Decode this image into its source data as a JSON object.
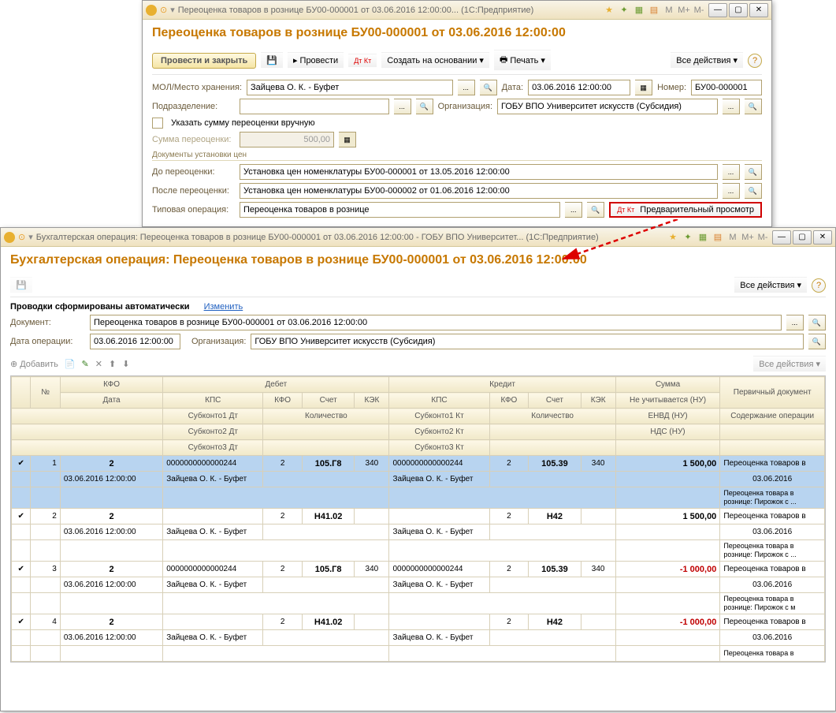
{
  "w1": {
    "title": "Переоценка товаров в рознице БУ00-000001 от 03.06.2016 12:00:00... (1С:Предприятие)",
    "heading": "Переоценка товаров в рознице БУ00-000001 от 03.06.2016 12:00:00",
    "btn_post_close": "Провести и закрыть",
    "btn_post": "Провести",
    "btn_create_based": "Создать на основании",
    "btn_print": "Печать",
    "btn_all_actions": "Все действия",
    "lbl_mol": "МОЛ/Место хранения:",
    "mol": "Зайцева О. К. - Буфет",
    "lbl_date": "Дата:",
    "date": "03.06.2016 12:00:00",
    "lbl_number": "Номер:",
    "number": "БУ00-000001",
    "lbl_dept": "Подразделение:",
    "lbl_org": "Организация:",
    "org": "ГОБУ ВПО Университет искусств (Субсидия)",
    "chk_manual": "Указать сумму переоценки вручную",
    "lbl_sum": "Сумма переоценки:",
    "sum": "500,00",
    "group_docs": "Документы установки цен",
    "lbl_before": "До переоценки:",
    "before": "Установка цен номенклатуры БУ00-000001 от 13.05.2016 12:00:00",
    "lbl_after": "После переоценки:",
    "after": "Установка цен номенклатуры БУ00-000002 от 01.06.2016 12:00:00",
    "lbl_typop": "Типовая операция:",
    "typop": "Переоценка товаров в рознице",
    "btn_preview": "Предварительный просмотр"
  },
  "w2": {
    "title": "Бухгалтерская операция: Переоценка товаров в рознице БУ00-000001 от 03.06.2016 12:00:00 - ГОБУ ВПО Университет... (1С:Предприятие)",
    "heading": "Бухгалтерская операция: Переоценка товаров в рознице БУ00-000001 от 03.06.2016 12:00:00",
    "btn_all_actions": "Все действия",
    "auto_text": "Проводки сформированы автоматически",
    "btn_change": "Изменить",
    "lbl_doc": "Документ:",
    "doc": "Переоценка товаров в рознице БУ00-000001 от 03.06.2016 12:00:00",
    "lbl_opdate": "Дата операции:",
    "opdate": "03.06.2016 12:00:00",
    "lbl_org": "Организация:",
    "org": "ГОБУ ВПО Университет искусств (Субсидия)",
    "btn_add": "Добавить",
    "h": {
      "n": "№",
      "kfo": "КФО",
      "debit": "Дебет",
      "credit": "Кредит",
      "sum": "Сумма",
      "primdoc": "Первичный документ",
      "date": "Дата",
      "kps": "КПС",
      "acct": "Счет",
      "kek": "КЭК",
      "qty": "Количество",
      "envd": "ЕНВД (НУ)",
      "notcount": "Не учитывается (НУ)",
      "sub1d": "Субконто1 Дт",
      "sub2d": "Субконто2 Дт",
      "sub3d": "Субконто3 Дт",
      "sub1k": "Субконто1 Кт",
      "sub2k": "Субконто2 Кт",
      "sub3k": "Субконто3 Кт",
      "nds": "НДС (НУ)",
      "desc": "Содержание операции"
    },
    "rows": [
      {
        "n": "1",
        "kfo": "2",
        "date": "03.06.2016 12:00:00",
        "d_kps": "0000000000000244",
        "d_kfo": "2",
        "d_acct": "105.Г8",
        "d_kek": "340",
        "d_sub1": "Зайцева О. К. - Буфет",
        "k_kps": "0000000000000244",
        "k_kfo": "2",
        "k_acct": "105.39",
        "k_kek": "340",
        "k_sub1": "Зайцева О. К. - Буфет",
        "sum": "1 500,00",
        "doc": "Переоценка товаров в",
        "docdate": "03.06.2016",
        "desc": "Переоценка товара в рознице: Пирожок с ..."
      },
      {
        "n": "2",
        "kfo": "2",
        "date": "03.06.2016 12:00:00",
        "d_kps": "",
        "d_kfo": "2",
        "d_acct": "Н41.02",
        "d_kek": "",
        "d_sub1": "Зайцева О. К. - Буфет",
        "k_kps": "",
        "k_kfo": "2",
        "k_acct": "Н42",
        "k_kek": "",
        "k_sub1": "Зайцева О. К. - Буфет",
        "sum": "1 500,00",
        "doc": "Переоценка товаров в",
        "docdate": "03.06.2016",
        "desc": "Переоценка товара в рознице: Пирожок с ..."
      },
      {
        "n": "3",
        "kfo": "2",
        "date": "03.06.2016 12:00:00",
        "d_kps": "0000000000000244",
        "d_kfo": "2",
        "d_acct": "105.Г8",
        "d_kek": "340",
        "d_sub1": "Зайцева О. К. - Буфет",
        "k_kps": "0000000000000244",
        "k_kfo": "2",
        "k_acct": "105.39",
        "k_kek": "340",
        "k_sub1": "Зайцева О. К. - Буфет",
        "sum": "-1 000,00",
        "doc": "Переоценка товаров в",
        "docdate": "03.06.2016",
        "desc": "Переоценка товара в рознице: Пирожок с м"
      },
      {
        "n": "4",
        "kfo": "2",
        "date": "03.06.2016 12:00:00",
        "d_kps": "",
        "d_kfo": "2",
        "d_acct": "Н41.02",
        "d_kek": "",
        "d_sub1": "Зайцева О. К. - Буфет",
        "k_kps": "",
        "k_kfo": "2",
        "k_acct": "Н42",
        "k_kek": "",
        "k_sub1": "Зайцева О. К. - Буфет",
        "sum": "-1 000,00",
        "doc": "Переоценка товаров в",
        "docdate": "03.06.2016",
        "desc": "Переоценка товара в"
      }
    ]
  }
}
